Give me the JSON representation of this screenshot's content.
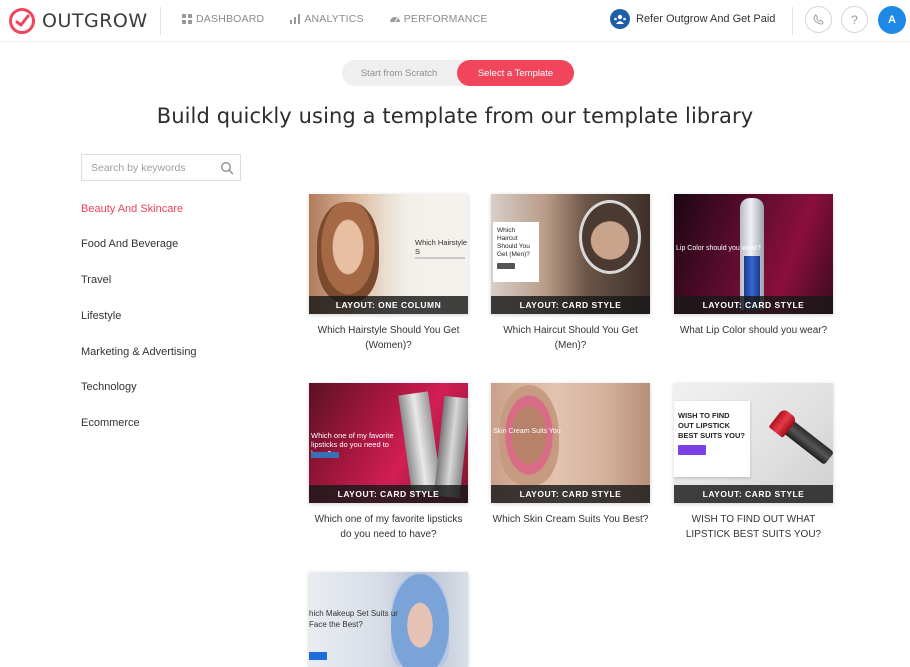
{
  "brand": {
    "name": "OUTGROW",
    "accent": "#f0455b"
  },
  "nav": [
    {
      "label": "DASHBOARD",
      "icon": "grid-icon"
    },
    {
      "label": "ANALYTICS",
      "icon": "bar-chart-icon"
    },
    {
      "label": "PERFORMANCE",
      "icon": "gauge-icon"
    }
  ],
  "header": {
    "refer_label": "Refer Outgrow And Get Paid",
    "phone_icon": "phone-icon",
    "help_label": "?",
    "avatar_initial": "A"
  },
  "toggle": {
    "scratch_label": "Start from Scratch",
    "template_label": "Select a Template",
    "selected": "Select a Template"
  },
  "headline": "Build quickly using a template from our template library",
  "search": {
    "placeholder": "Search by keywords",
    "value": ""
  },
  "categories": [
    {
      "label": "Beauty And Skincare",
      "active": true
    },
    {
      "label": "Food And Beverage",
      "active": false
    },
    {
      "label": "Travel",
      "active": false
    },
    {
      "label": "Lifestyle",
      "active": false
    },
    {
      "label": "Marketing & Advertising",
      "active": false
    },
    {
      "label": "Technology",
      "active": false
    },
    {
      "label": "Ecommerce",
      "active": false
    }
  ],
  "templates": [
    {
      "layout": "LAYOUT: ONE COLUMN",
      "title": "Which Hairstyle Should You Get (Women)?",
      "preview_text": "Which Hairstyle S"
    },
    {
      "layout": "LAYOUT: CARD STYLE",
      "title": "Which Haircut Should You Get (Men)?",
      "preview_text": "Which Haircut Should You Get (Men)?"
    },
    {
      "layout": "LAYOUT: CARD STYLE",
      "title": "What Lip Color should you wear?",
      "preview_text": "Lip Color should you wear?"
    },
    {
      "layout": "LAYOUT: CARD STYLE",
      "title": "Which one of my favorite lipsticks do you need to have?",
      "preview_text": "Which one of my favorite lipsticks do you need to have?"
    },
    {
      "layout": "LAYOUT: CARD STYLE",
      "title": "Which Skin Cream Suits You Best?",
      "preview_text": "Skin Cream Suits You"
    },
    {
      "layout": "LAYOUT: CARD STYLE",
      "title": "WISH TO FIND OUT WHAT LIPSTICK BEST SUITS YOU?",
      "preview_text": "WISH TO FIND OUT LIPSTICK BEST SUITS YOU?"
    },
    {
      "layout": "",
      "title": "",
      "preview_text": "hich Makeup Set Suits ur Face the Best?"
    }
  ]
}
